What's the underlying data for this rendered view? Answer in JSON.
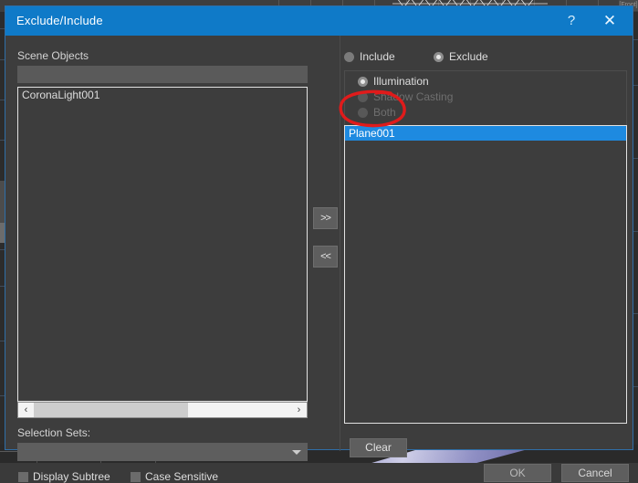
{
  "dialog": {
    "title": "Exclude/Include",
    "help_icon": "?",
    "close_icon": "✕"
  },
  "left": {
    "scene_objects_label": "Scene Objects",
    "filter_value": "",
    "filter_placeholder": "",
    "scene_items": [
      "CoronaLight001"
    ],
    "scroll_left_arrow": "‹",
    "scroll_right_arrow": "›",
    "selection_sets_label": "Selection Sets:",
    "selection_sets_value": "",
    "checkboxes": [
      {
        "label": "Display Subtree",
        "checked": false
      },
      {
        "label": "Case Sensitive",
        "checked": false
      }
    ]
  },
  "transfer": {
    "add_label": ">>",
    "remove_label": "<<"
  },
  "right": {
    "mode_radios": [
      {
        "label": "Include",
        "selected": false
      },
      {
        "label": "Exclude",
        "selected": true
      }
    ],
    "effect_radios": [
      {
        "label": "Illumination",
        "selected": true,
        "disabled": false
      },
      {
        "label": "Shadow Casting",
        "selected": false,
        "disabled": true
      },
      {
        "label": "Both",
        "selected": false,
        "disabled": true
      }
    ],
    "excluded_items": [
      {
        "label": "Plane001",
        "selected": true
      }
    ],
    "clear_label": "Clear",
    "ok_label": "OK",
    "cancel_label": "Cancel"
  },
  "annotation": {
    "shape": "red-ellipse",
    "target": "Both",
    "color": "#e01b1b"
  },
  "colors": {
    "titlebar": "#0f7ac8",
    "dialog_bg": "#3d3d3d",
    "selection": "#1e8ae0",
    "annotation_red": "#e01b1b",
    "list_border": "#e2e2e2"
  }
}
